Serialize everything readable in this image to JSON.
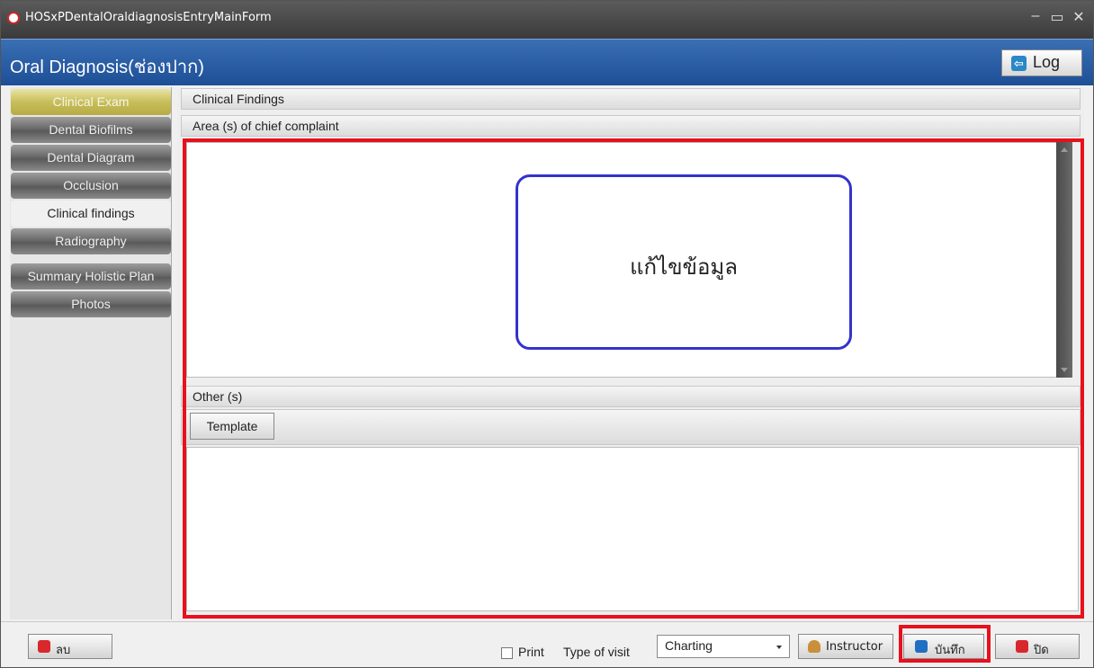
{
  "window": {
    "title": "HOSxPDentalOraldiagnosisEntryMainForm",
    "min": "–",
    "max": "▭",
    "close": "✕"
  },
  "header": {
    "title": "Oral Diagnosis(ช่องปาก)",
    "log_label": "Log"
  },
  "sidebar": {
    "items": [
      {
        "label": "Clinical Exam"
      },
      {
        "label": "Dental Biofilms"
      },
      {
        "label": "Dental Diagram"
      },
      {
        "label": "Occlusion"
      },
      {
        "label": "Clinical findings"
      },
      {
        "label": "Radiography"
      },
      {
        "label": "Summary Holistic Plan"
      },
      {
        "label": "Photos"
      }
    ]
  },
  "main": {
    "section_title": "Clinical Findings",
    "chief_complaint_label": "Area (s) of chief complaint",
    "edit_overlay_text": "แก้ไขข้อมูล",
    "other_label": "Other (s)",
    "template_button": "Template"
  },
  "footer": {
    "delete_label": "ลบ",
    "print_label": "Print",
    "type_of_visit_label": "Type of visit",
    "type_of_visit_value": "Charting",
    "instructor_label": "Instructor",
    "save_label": "บันทึก",
    "close_label": "ปิด"
  },
  "colors": {
    "highlight": "#e8101c",
    "callout_border": "#3333cc",
    "header_blue": "#1d4f97"
  }
}
